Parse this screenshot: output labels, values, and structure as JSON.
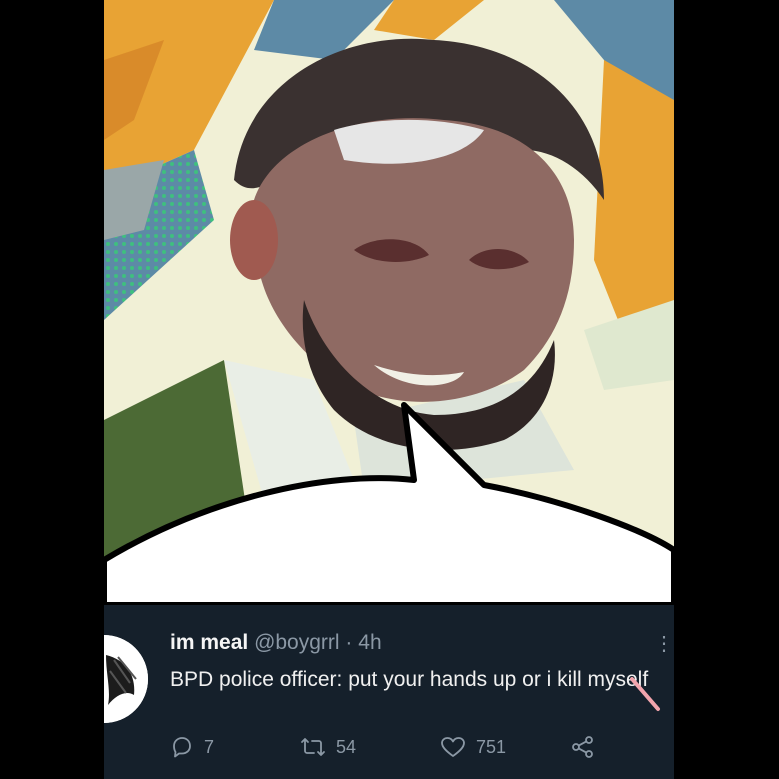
{
  "tweet": {
    "display_name": "im meal",
    "handle": "@boygrrl",
    "separator": "·",
    "time": "4h",
    "text": "BPD police officer: put your hands up or i kill myself",
    "more_glyph": "⋮",
    "actions": {
      "reply_count": "7",
      "retweet_count": "54",
      "like_count": "751"
    }
  },
  "icons": [
    "reply-icon",
    "retweet-icon",
    "like-icon",
    "share-icon",
    "avatar-icon",
    "more-icon"
  ],
  "colors": {
    "tweet_bg": "#15202b",
    "text": "#e7e9ea",
    "muted": "#8b98a5",
    "speech_bubble": "#ffffff",
    "art_orange": "#e8a334",
    "art_blue": "#5d8aa6",
    "art_cream": "#f1f0d6",
    "jacket_green": "#4c6a35"
  }
}
